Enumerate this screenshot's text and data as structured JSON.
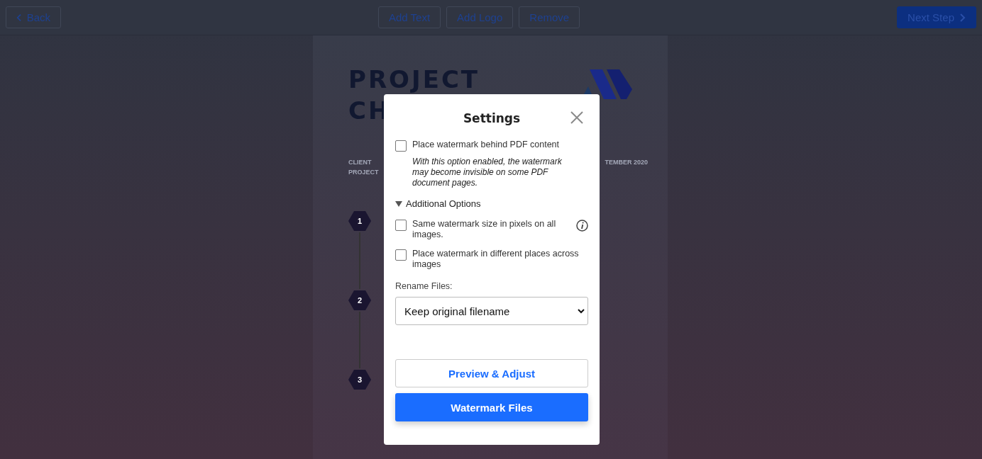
{
  "toolbar": {
    "back": "Back",
    "actions": [
      "Add Text",
      "Add Logo",
      "Remove"
    ],
    "next": "Next Step"
  },
  "document": {
    "title_lines": [
      "PROJECT",
      "CH"
    ],
    "meta": [
      "CLIENT",
      "PROJECT"
    ],
    "date": "TEMBER 2020",
    "steps": [
      "1",
      "2",
      "3"
    ]
  },
  "dialog": {
    "title": "Settings",
    "options": [
      {
        "kind": "checkbox",
        "label": "Place watermark behind PDF content",
        "checked": false,
        "note": "With this option enabled, the watermark may become invisible on some PDF document pages."
      },
      {
        "kind": "section",
        "label": "Additional Options",
        "expanded": true
      },
      {
        "kind": "checkbox",
        "label": "Same watermark size in pixels on all images.",
        "checked": false,
        "info": true
      },
      {
        "kind": "checkbox",
        "label": "Place watermark in different places across images",
        "checked": false
      }
    ],
    "rename": {
      "label": "Rename Files:",
      "value": "Keep original filename"
    },
    "buttons": [
      {
        "label": "Preview & Adjust",
        "kind": "secondary"
      },
      {
        "label": "Watermark Files",
        "kind": "primary"
      }
    ]
  }
}
